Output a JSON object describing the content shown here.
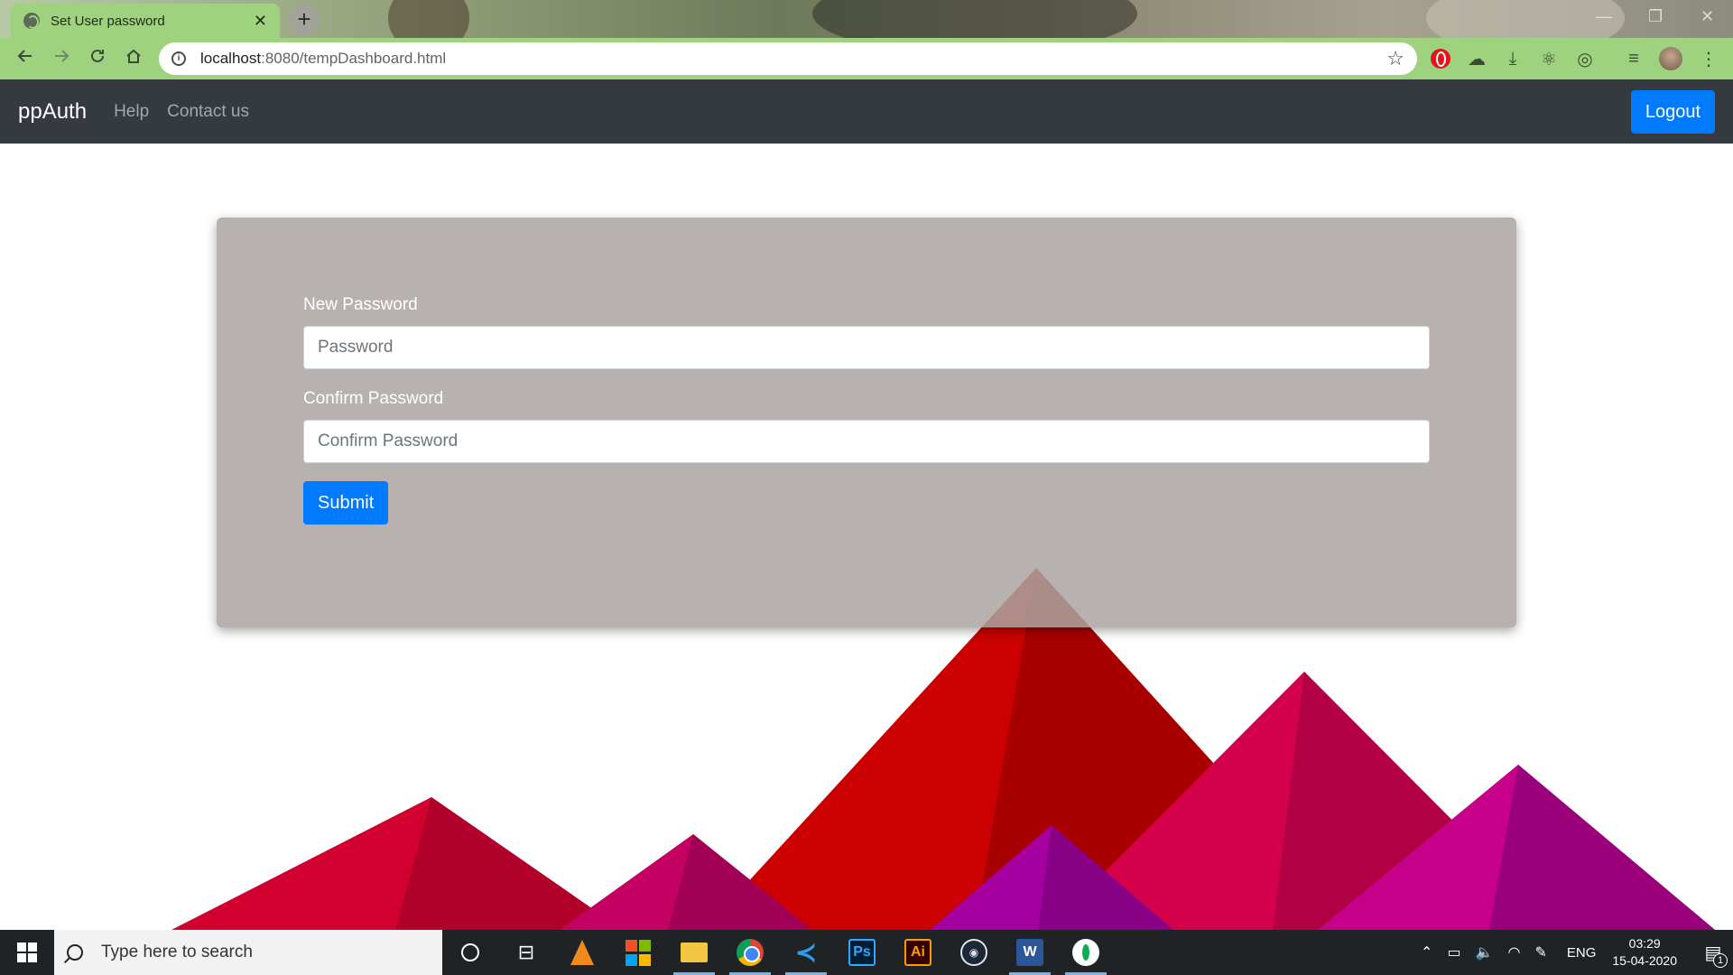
{
  "browser": {
    "tab_title": "Set User password",
    "tab_close": "✕",
    "new_tab": "+",
    "url_host": "localhost",
    "url_rest": ":8080/tempDashboard.html",
    "window_controls": [
      "—",
      "❐",
      "✕"
    ],
    "nav_icons": [
      "back-icon",
      "forward-icon",
      "reload-icon",
      "home-icon"
    ],
    "extensions": [
      "opera-icon",
      "cloud-icon",
      "download-icon",
      "react-icon",
      "sync-icon",
      "media-icon",
      "avatar",
      "menu-icon"
    ]
  },
  "navbar": {
    "brand": "ppAuth",
    "links": [
      "Help",
      "Contact us"
    ],
    "logout_label": "Logout",
    "bg_color": "#343a40",
    "accent_color": "#007bff"
  },
  "form": {
    "new_password_label": "New Password",
    "new_password_placeholder": "Password",
    "confirm_password_label": "Confirm Password",
    "confirm_password_placeholder": "Confirm Password",
    "submit_label": "Submit"
  },
  "taskbar": {
    "search_placeholder": "Type here to search",
    "apps": [
      "cortana",
      "task-view",
      "vlc",
      "microsoft-store",
      "file-explorer",
      "chrome",
      "vscode",
      "photoshop",
      "illustrator",
      "steam",
      "word",
      "mongodb-compass"
    ],
    "ps_label": "Ps",
    "ai_label": "Ai",
    "word_label": "W",
    "language": "ENG",
    "time": "03:29",
    "date": "15-04-2020",
    "notification_count": "1"
  }
}
